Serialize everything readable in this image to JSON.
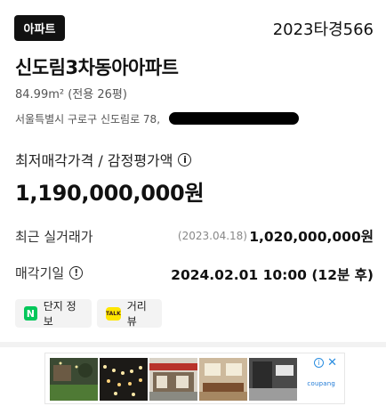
{
  "header": {
    "type_badge": "아파트",
    "case_number": "2023타경566"
  },
  "property": {
    "name": "신도림3차동아아파트",
    "area": "84.99m² (전용 26평)",
    "address": "서울특별시 구로구 신도림로 78,"
  },
  "price": {
    "label": "최저매각가격 / 감정평가액",
    "value": "1,190,000,000원"
  },
  "recent_trade": {
    "label": "최근 실거래가",
    "date": "(2023.04.18)",
    "value": "1,020,000,000원"
  },
  "sale_date": {
    "label": "매각기일",
    "value": "2024.02.01 10:00 (12분 후)"
  },
  "chips": {
    "complex_info": "단지 정보",
    "street_view": "거리뷰"
  },
  "icons": {
    "info": "info-circle-icon",
    "naver": "naver-n-icon",
    "kakao": "kakao-talk-icon",
    "ad_info": "ad-info-icon",
    "ad_close": "close-icon"
  },
  "ad": {
    "brand": "coupang"
  },
  "colors": {
    "naver_green": "#03c75a",
    "kakao_yellow": "#fee500",
    "ad_blue": "#2a8de0"
  }
}
